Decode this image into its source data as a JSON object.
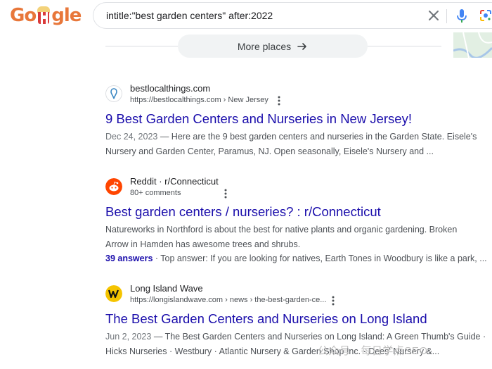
{
  "search": {
    "query": "intitle:\"best garden centers\" after:2022"
  },
  "more_places": {
    "label": "More places"
  },
  "results": [
    {
      "site_name": "bestlocalthings.com",
      "url": "https://bestlocalthings.com › New Jersey",
      "title": "9 Best Garden Centers and Nurseries in New Jersey!",
      "date": "Dec 24, 2023",
      "line1": " — Here are the 9 best garden centers and nurseries in the Garden State. Eisele's",
      "line2": "Nursery and Garden Center, Paramus, NJ. Open seasonally, Eisele's Nursery and ..."
    },
    {
      "site_name": "Reddit · r/Connecticut",
      "url": "80+ comments",
      "title": "Best garden centers / nurseries? : r/Connecticut",
      "line1": "Natureworks in Northford is about the best for native plants and organic gardening. Broken",
      "line2": "Arrow in Hamden has awesome trees and shrubs.",
      "answers": "39 answers",
      "answers_meta": " · Top answer: If you are looking for natives, Earth Tones in Woodbury is like a park, ..."
    },
    {
      "site_name": "Long Island Wave",
      "url": "https://longislandwave.com › news › the-best-garden-ce...",
      "title": "The Best Garden Centers and Nurseries on Long Island",
      "date": "Jun 2, 2023",
      "line1": " — The Best Garden Centers and Nurseries on Long Island: A Green Thumb's Guide ·",
      "line2": "Hicks Nurseries · Westbury · Atlantic Nursery & Garden Shop Inc. · Dees' Nursery &..."
    }
  ],
  "watermark": "公众号 · 每日学点SEO",
  "colors": {
    "link": "#1a0dab",
    "snippet": "#4d5156",
    "logo": "#e8773a"
  }
}
